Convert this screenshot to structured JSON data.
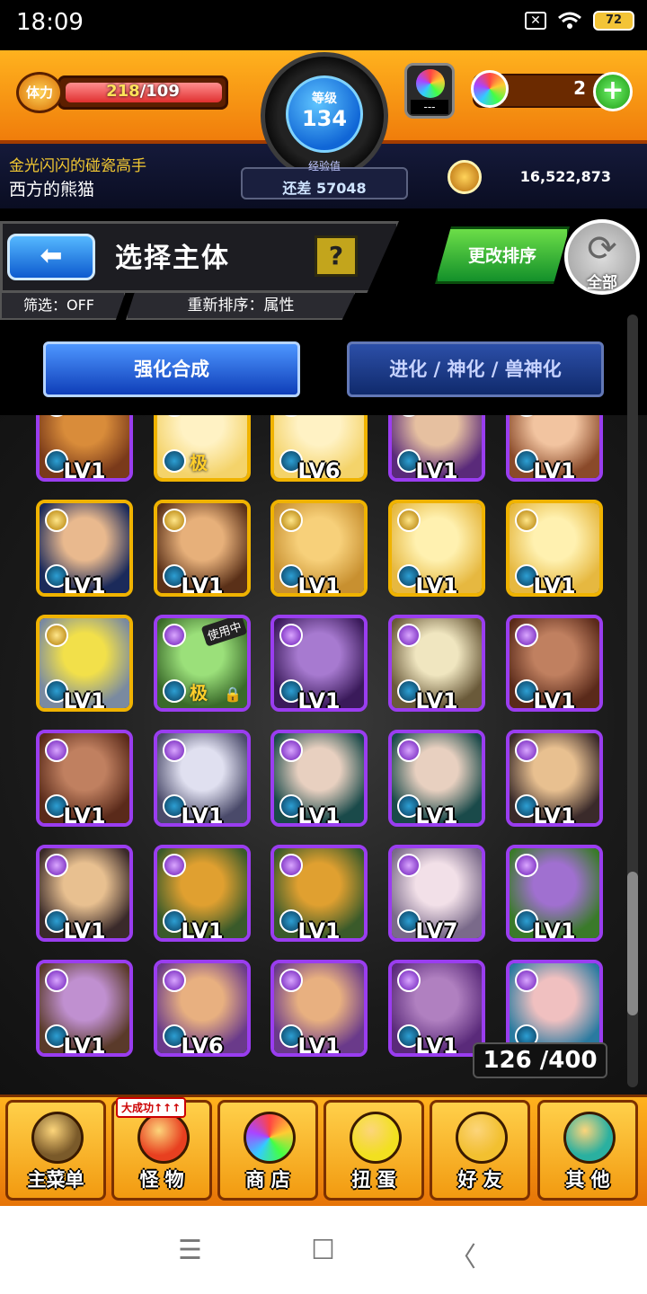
{
  "status_bar": {
    "time": "18:09",
    "battery": "72",
    "close_glyph": "✕"
  },
  "header": {
    "stamina_label": "体力",
    "stamina_current": "218",
    "stamina_max": "/109",
    "level_label": "等级",
    "level": "134",
    "exp_label": "经验值",
    "exp_remaining": "还差 57048",
    "orb_slot": "---",
    "gems": "2",
    "title": "金光闪闪的碰瓷高手",
    "username": "西方的熊猫",
    "gold": "16,522,873"
  },
  "panel": {
    "back_glyph": "⬅",
    "title": "选择主体",
    "help": "?",
    "filter": "筛选：OFF",
    "sort": "重新排序：属性",
    "change_order": "更改排序",
    "all": "全部",
    "tab_fuse": "强化合成",
    "tab_evolve": "进化 / 神化 / 兽神化"
  },
  "monsters": [
    {
      "lv": "LV1",
      "elem": "pu",
      "c1": "#7a3a1a",
      "c2": "#d98c3a"
    },
    {
      "lv": "",
      "elem": "ye",
      "c1": "#f4d36a",
      "c2": "#fff2c4",
      "kyoku": "极"
    },
    {
      "lv": "LV6",
      "elem": "ye",
      "c1": "#f4d36a",
      "c2": "#fff2c4"
    },
    {
      "lv": "LV1",
      "elem": "pu",
      "c1": "#5a2a7a",
      "c2": "#e6c0a0"
    },
    {
      "lv": "LV1",
      "elem": "pu",
      "c1": "#8a4a2a",
      "c2": "#f2c4a0"
    },
    {
      "lv": "LV1",
      "elem": "ye",
      "c1": "#1b2a5a",
      "c2": "#e9b98e"
    },
    {
      "lv": "LV1",
      "elem": "ye",
      "c1": "#5a3018",
      "c2": "#e7b07a"
    },
    {
      "lv": "LV1",
      "elem": "ye",
      "c1": "#c89030",
      "c2": "#f7d07a"
    },
    {
      "lv": "LV1",
      "elem": "ye",
      "c1": "#e6b840",
      "c2": "#fff1b0"
    },
    {
      "lv": "LV1",
      "elem": "ye",
      "c1": "#e6b840",
      "c2": "#fff1b0"
    },
    {
      "lv": "LV1",
      "elem": "ye",
      "c1": "#7a8aa0",
      "c2": "#f2e04a"
    },
    {
      "lv": "",
      "elem": "pu",
      "c1": "#3a6a2a",
      "c2": "#9be07a",
      "kyoku": "极",
      "tag": "使用中"
    },
    {
      "lv": "LV1",
      "elem": "pu",
      "c1": "#3a1a5a",
      "c2": "#a77ad0"
    },
    {
      "lv": "LV1",
      "elem": "pu",
      "c1": "#6a5a3a",
      "c2": "#f0e6c0"
    },
    {
      "lv": "LV1",
      "elem": "pu",
      "c1": "#5a2a1a",
      "c2": "#c08060"
    },
    {
      "lv": "LV1",
      "elem": "pu",
      "c1": "#5a2a1a",
      "c2": "#c08060"
    },
    {
      "lv": "LV1",
      "elem": "pu",
      "c1": "#4a4a6a",
      "c2": "#e0e0f0"
    },
    {
      "lv": "LV1",
      "elem": "pu",
      "c1": "#1a4a4a",
      "c2": "#e8d0c0"
    },
    {
      "lv": "LV1",
      "elem": "pu",
      "c1": "#1a4a4a",
      "c2": "#e8d0c0"
    },
    {
      "lv": "LV1",
      "elem": "pu",
      "c1": "#3a2a2a",
      "c2": "#e8c090"
    },
    {
      "lv": "LV1",
      "elem": "pu",
      "c1": "#3a2a2a",
      "c2": "#e8c090"
    },
    {
      "lv": "LV1",
      "elem": "pu",
      "c1": "#3a5a2a",
      "c2": "#e0a030"
    },
    {
      "lv": "LV1",
      "elem": "pu",
      "c1": "#3a5a2a",
      "c2": "#e0a030"
    },
    {
      "lv": "LV7",
      "elem": "pu",
      "c1": "#7a6a8a",
      "c2": "#f2e0e8"
    },
    {
      "lv": "LV1",
      "elem": "pu",
      "c1": "#3a7a2a",
      "c2": "#a070d0"
    },
    {
      "lv": "LV1",
      "elem": "pu",
      "c1": "#5a3a2a",
      "c2": "#c090d0"
    },
    {
      "lv": "LV6",
      "elem": "pu",
      "c1": "#6a3a8a",
      "c2": "#e8b080"
    },
    {
      "lv": "LV1",
      "elem": "pu",
      "c1": "#6a3a8a",
      "c2": "#e8b080"
    },
    {
      "lv": "LV1",
      "elem": "pu",
      "c1": "#5a2a7a",
      "c2": "#b080c0"
    },
    {
      "lv": "",
      "elem": "pu",
      "c1": "#2a7aa0",
      "c2": "#f0c0c0"
    }
  ],
  "counter": "126 /400",
  "nav": [
    {
      "label": "主菜单",
      "color": "#7a5a2a"
    },
    {
      "label": "怪 物",
      "color": "#e84020",
      "badge": "大成功↑↑↑"
    },
    {
      "label": "商 店",
      "color": "#ffffff"
    },
    {
      "label": "扭 蛋",
      "color": "#f2e020"
    },
    {
      "label": "好 友",
      "color": "#f2c030"
    },
    {
      "label": "其 他",
      "color": "#2ab0a0"
    }
  ],
  "sysnav": {
    "menu": "☰",
    "home": "☐",
    "back": "〈"
  }
}
